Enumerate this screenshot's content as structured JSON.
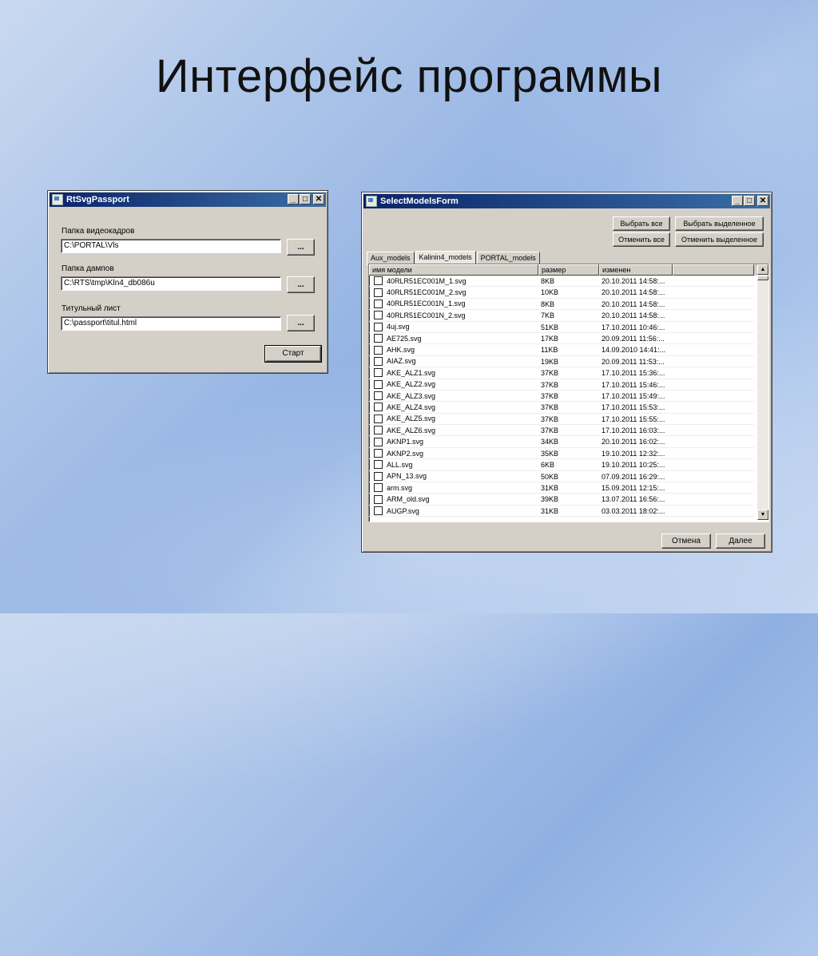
{
  "slide": {
    "title": "Интерфейс программы"
  },
  "passport_window": {
    "title": "RtSvgPassport",
    "fields": [
      {
        "label": "Папка видеокадров",
        "value": "C:\\PORTAL\\Vls",
        "browse": "..."
      },
      {
        "label": "Папка дампов",
        "value": "C:\\RTS\\tmp\\Kln4_db086u",
        "browse": "..."
      },
      {
        "label": "Титульный лист",
        "value": "C:\\passport\\titul.html",
        "browse": "..."
      }
    ],
    "start_button": "Старт"
  },
  "models_window": {
    "title": "SelectModelsForm",
    "buttons": {
      "select_all": "Выбрать все",
      "select_selected": "Выбрать выделенное",
      "deselect_all": "Отменить все",
      "deselect_selected": "Отменить выделенное",
      "cancel": "Отмена",
      "next": "Далее"
    },
    "tabs": [
      "Aux_models",
      "Kalinin4_models",
      "PORTAL_models"
    ],
    "active_tab": "Kalinin4_models",
    "columns": [
      "имя модели",
      "размер",
      "изменен",
      ""
    ],
    "rows": [
      [
        "40RLR51EC001M_1.svg",
        "8KB",
        "20.10.2011 14:58:..."
      ],
      [
        "40RLR51EC001M_2.svg",
        "10KB",
        "20.10.2011 14:58:..."
      ],
      [
        "40RLR51EC001N_1.svg",
        "8KB",
        "20.10.2011 14:58:..."
      ],
      [
        "40RLR51EC001N_2.svg",
        "7KB",
        "20.10.2011 14:58:..."
      ],
      [
        "4uj.svg",
        "51KB",
        "17.10.2011 10:46:..."
      ],
      [
        "AE725.svg",
        "17KB",
        "20.09.2011 11:56:..."
      ],
      [
        "AHK.svg",
        "11KB",
        "14.09.2010 14:41:..."
      ],
      [
        "AIAZ.svg",
        "19KB",
        "20.09.2011 11:53:..."
      ],
      [
        "AKE_ALZ1.svg",
        "37KB",
        "17.10.2011 15:36:..."
      ],
      [
        "AKE_ALZ2.svg",
        "37KB",
        "17.10.2011 15:46:..."
      ],
      [
        "AKE_ALZ3.svg",
        "37KB",
        "17.10.2011 15:49:..."
      ],
      [
        "AKE_ALZ4.svg",
        "37KB",
        "17.10.2011 15:53:..."
      ],
      [
        "AKE_ALZ5.svg",
        "37KB",
        "17.10.2011 15:55:..."
      ],
      [
        "AKE_ALZ6.svg",
        "37KB",
        "17.10.2011 16:03:..."
      ],
      [
        "AKNP1.svg",
        "34KB",
        "20.10.2011 16:02:..."
      ],
      [
        "AKNP2.svg",
        "35KB",
        "19.10.2011 12:32:..."
      ],
      [
        "ALL.svg",
        "6KB",
        "19.10.2011 10:25:..."
      ],
      [
        "APN_13.svg",
        "50KB",
        "07.09.2011 16:29:..."
      ],
      [
        "arm.svg",
        "31KB",
        "15.09.2011 12:15:..."
      ],
      [
        "ARM_old.svg",
        "39KB",
        "13.07.2011 16:56:..."
      ],
      [
        "AUGP.svg",
        "31KB",
        "03.03.2011 18:02:..."
      ]
    ]
  },
  "window_controls": {
    "minimize": "_",
    "maximize": "□",
    "close": "✕"
  }
}
